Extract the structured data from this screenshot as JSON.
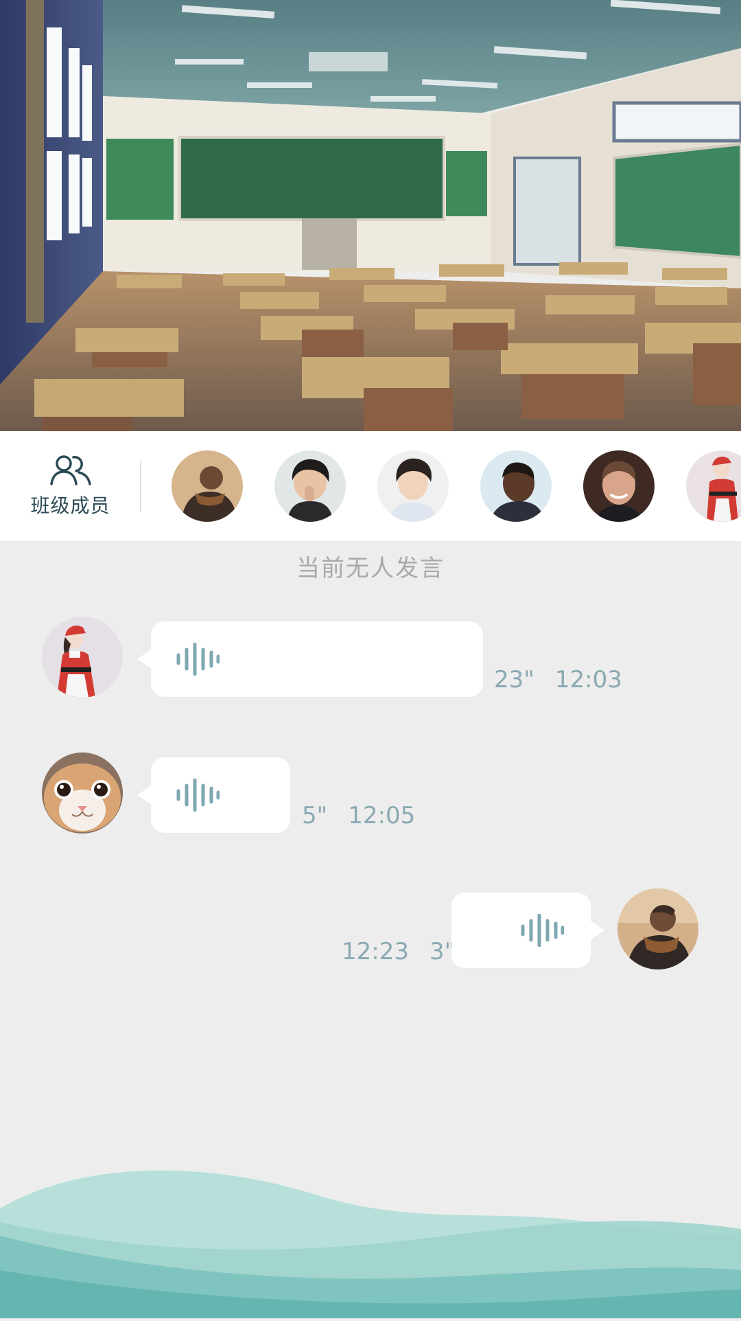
{
  "members": {
    "label": "班级成员",
    "icon": "group-icon",
    "avatars": [
      "member-avatar-1",
      "member-avatar-2",
      "member-avatar-3",
      "member-avatar-4",
      "member-avatar-5",
      "member-avatar-6"
    ]
  },
  "status": "当前无人发言",
  "messages": [
    {
      "side": "left",
      "avatar": "avatar-santa-girl",
      "duration": "23\"",
      "time": "12:03"
    },
    {
      "side": "left",
      "avatar": "avatar-cat",
      "duration": "5\"",
      "time": "12:05"
    },
    {
      "side": "right",
      "avatar": "avatar-self",
      "duration": "3\"",
      "time": "12:23"
    }
  ],
  "colors": {
    "accent": "#7fa7b2",
    "member_icon": "#2c4a55",
    "background": "#ededed",
    "wave_light": "#9fd7cf",
    "wave_dark": "#5fb8b4"
  }
}
